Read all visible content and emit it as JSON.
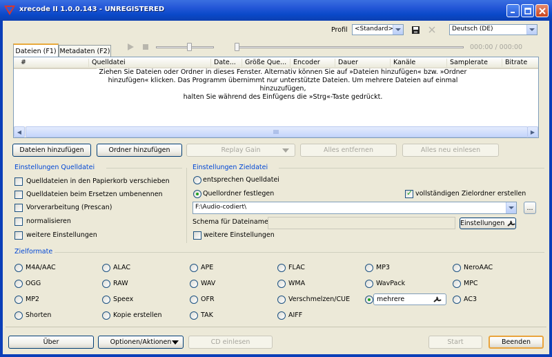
{
  "window": {
    "title": "xrecode II 1.0.0.143 - UNREGISTERED"
  },
  "toolbar": {
    "profil_label": "Profil",
    "profile_value": "<Standard>",
    "language_value": "Deutsch (DE)",
    "time_display": "000:00 / 000:00"
  },
  "tabs": [
    {
      "label": "Dateien (F1)"
    },
    {
      "label": "Metadaten (F2)"
    }
  ],
  "file_list": {
    "columns": [
      "#",
      "Quelldatei",
      "Date...",
      "Größe Que...",
      "Encoder",
      "Dauer",
      "Kanäle",
      "Samplerate",
      "Bitrate"
    ],
    "hint_lines": [
      "Ziehen Sie Dateien oder Ordner in dieses Fenster. Alternativ können Sie auf »Dateien hinzufügen« bzw. »Ordner",
      "hinzufügen« klicken. Das Programm übernimmt nur unterstützte Dateien. Um mehrere Dateien auf einmal hinzuzufügen,",
      "halten Sie während des Einfügens die »Strg«-Taste gedrückt."
    ]
  },
  "actions": {
    "add_files": "Dateien hinzufügen",
    "add_folder": "Ordner hinzufügen",
    "replay_gain": "Replay Gain",
    "remove_all": "Alles entfernen",
    "reload_all": "Alles neu einlesen"
  },
  "source_settings": {
    "title": "Einstellungen Quelldatei",
    "options": [
      {
        "label": "Quelldateien in den Papierkorb verschieben",
        "checked": false
      },
      {
        "label": "Quelldateien beim Ersetzen umbenennen",
        "checked": false
      },
      {
        "label": "Vorverarbeitung (Prescan)",
        "checked": false
      },
      {
        "label": "normalisieren",
        "checked": false
      },
      {
        "label": "weitere Einstellungen",
        "checked": false
      }
    ]
  },
  "target_settings": {
    "title": "Einstellungen Zieldatei",
    "radio_same": "entsprechen Quelldatei",
    "radio_folder": "Quellordner festlegen",
    "full_path_label": "vollständigen Zielordner erstellen",
    "folder_value": "F:\\Audio-codiert\\",
    "browse_label": "...",
    "schema_label": "Schema für Dateinamen",
    "schema_value": "",
    "settings_button": "Einstellungen",
    "more_settings": "weitere Einstellungen"
  },
  "formats": {
    "title": "Zielformate",
    "rows": [
      [
        "M4A/AAC",
        "ALAC",
        "APE",
        "FLAC",
        "MP3",
        "NeroAAC"
      ],
      [
        "OGG",
        "RAW",
        "WAV",
        "WMA",
        "WavPack",
        "MPC"
      ],
      [
        "MP2",
        "Speex",
        "OFR",
        "Verschmelzen/CUE",
        "mehrere",
        "AC3"
      ],
      [
        "Shorten",
        "Kopie erstellen",
        "TAK",
        "AIFF"
      ]
    ],
    "selected": "mehrere"
  },
  "footer": {
    "about": "Über",
    "options": "Optionen/Aktionen",
    "cd_read": "CD einlesen",
    "start": "Start",
    "quit": "Beenden"
  }
}
